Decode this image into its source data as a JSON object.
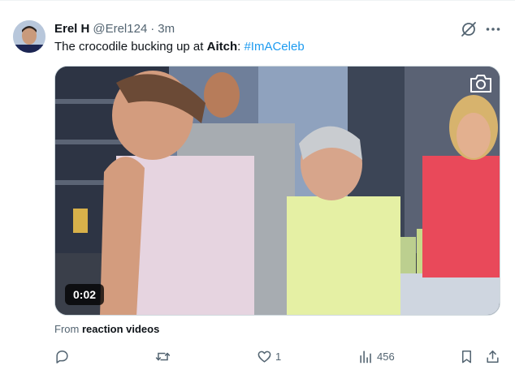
{
  "tweet": {
    "author_name": "Erel H",
    "author_handle": "@Erel124",
    "separator": "·",
    "time": "3m",
    "text_prefix": "The crocodile bucking up at ",
    "mention": "Aitch",
    "text_mid": ": ",
    "hashtag": "#ImACeleb"
  },
  "media": {
    "duration": "0:02"
  },
  "attribution": {
    "prefix": "From ",
    "source": "reaction videos"
  },
  "actions": {
    "reply_count": "",
    "retweet_count": "",
    "like_count": "1",
    "views_count": "456"
  },
  "colors": {
    "accent": "#1d9bf0",
    "secondary_text": "#536471",
    "primary_text": "#0f1419"
  },
  "icons": [
    "grok-icon",
    "more-icon",
    "camera-icon",
    "reply-icon",
    "retweet-icon",
    "like-icon",
    "views-icon",
    "bookmark-icon",
    "share-icon"
  ]
}
